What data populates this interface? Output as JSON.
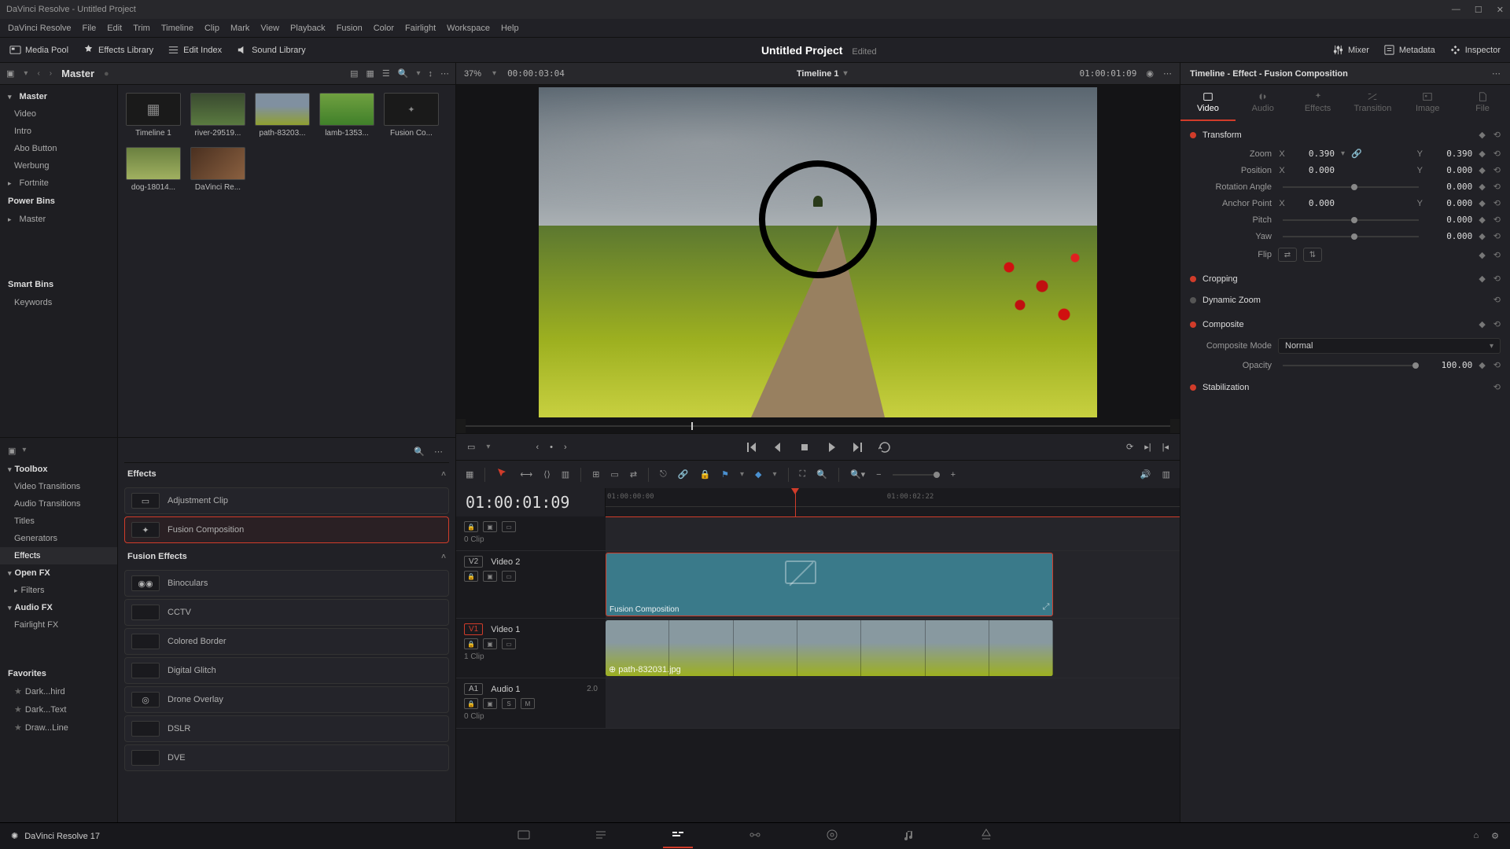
{
  "window_title": "DaVinci Resolve - Untitled Project",
  "menu": [
    "DaVinci Resolve",
    "File",
    "Edit",
    "Trim",
    "Timeline",
    "Clip",
    "Mark",
    "View",
    "Playback",
    "Fusion",
    "Color",
    "Fairlight",
    "Workspace",
    "Help"
  ],
  "topbar": {
    "media_pool": "Media Pool",
    "effects_library": "Effects Library",
    "edit_index": "Edit Index",
    "sound_library": "Sound Library",
    "project_name": "Untitled Project",
    "project_status": "Edited",
    "mixer": "Mixer",
    "metadata": "Metadata",
    "inspector": "Inspector"
  },
  "pool": {
    "breadcrumb": "Master",
    "zoom_pct": "37%",
    "src_timecode": "00:00:03:04",
    "timeline_name": "Timeline 1",
    "rec_timecode": "01:00:01:09",
    "sidebar": {
      "master": "Master",
      "items": [
        "Video",
        "Intro",
        "Abo Button",
        "Werbung",
        "Fortnite"
      ],
      "power_bins": "Power Bins",
      "smart_bins": "Smart Bins",
      "keywords": "Keywords"
    },
    "clips": [
      {
        "label": "Timeline 1",
        "type": "timeline"
      },
      {
        "label": "river-29519...",
        "type": "img"
      },
      {
        "label": "path-83203...",
        "type": "img"
      },
      {
        "label": "lamb-1353...",
        "type": "img"
      },
      {
        "label": "Fusion Co...",
        "type": "fusion"
      },
      {
        "label": "dog-18014...",
        "type": "img"
      },
      {
        "label": "DaVinci Re...",
        "type": "img"
      }
    ]
  },
  "effects_panel": {
    "header": "Effects",
    "cats": {
      "toolbox": "Toolbox",
      "video_trans": "Video Transitions",
      "audio_trans": "Audio Transitions",
      "titles": "Titles",
      "generators": "Generators",
      "effects": "Effects",
      "openfx": "Open FX",
      "filters": "Filters",
      "audiofx": "Audio FX",
      "fairlightfx": "Fairlight FX",
      "favorites": "Favorites",
      "fav_items": [
        "Dark...hird",
        "Dark...Text",
        "Draw...Line"
      ]
    },
    "list": {
      "effects_hdr": "Effects",
      "fusion_hdr": "Fusion Effects",
      "items1": [
        "Adjustment Clip",
        "Fusion Composition"
      ],
      "items2": [
        "Binoculars",
        "CCTV",
        "Colored Border",
        "Digital Glitch",
        "Drone Overlay",
        "DSLR",
        "DVE"
      ]
    }
  },
  "timeline": {
    "timecode": "01:00:01:09",
    "ruler": [
      "01:00:00:00",
      "01:00:02:22"
    ],
    "tracks": {
      "v2": {
        "badge": "V2",
        "name": "Video 2",
        "clip_label": "Fusion Composition"
      },
      "v1": {
        "badge": "V1",
        "name": "Video 1",
        "clips_text": "1 Clip",
        "clip_file": "path-832031.jpg"
      },
      "a1": {
        "badge": "A1",
        "name": "Audio 1",
        "ch": "2.0",
        "clips_text": "0 Clip"
      },
      "hidden_clips": "0 Clip"
    }
  },
  "inspector": {
    "title": "Timeline - Effect - Fusion Composition",
    "tabs": [
      "Video",
      "Audio",
      "Effects",
      "Transition",
      "Image",
      "File"
    ],
    "transform": {
      "title": "Transform",
      "zoom_label": "Zoom",
      "zoom_x": "0.390",
      "zoom_y": "0.390",
      "pos_label": "Position",
      "pos_x": "0.000",
      "pos_y": "0.000",
      "rot_label": "Rotation Angle",
      "rot": "0.000",
      "anchor_label": "Anchor Point",
      "anchor_x": "0.000",
      "anchor_y": "0.000",
      "pitch_label": "Pitch",
      "pitch": "0.000",
      "yaw_label": "Yaw",
      "yaw": "0.000",
      "flip_label": "Flip"
    },
    "cropping": "Cropping",
    "dynamic_zoom": "Dynamic Zoom",
    "composite": {
      "title": "Composite",
      "mode_label": "Composite Mode",
      "mode_value": "Normal",
      "opacity_label": "Opacity",
      "opacity_value": "100.00"
    },
    "stabilization": "Stabilization"
  },
  "footer": {
    "brand": "DaVinci Resolve 17"
  }
}
